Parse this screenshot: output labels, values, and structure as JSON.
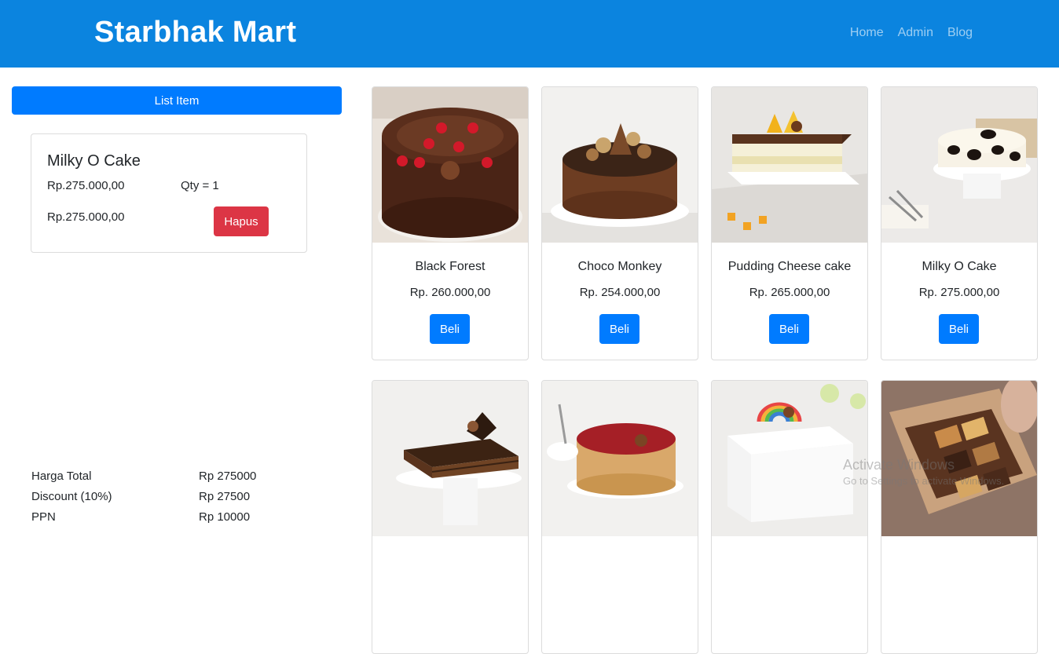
{
  "navbar": {
    "brand": "Starbhak Mart",
    "links": [
      "Home",
      "Admin",
      "Blog"
    ],
    "color": "#0b84df"
  },
  "sidebar": {
    "list_button": "List Item",
    "cart": {
      "name": "Milky O Cake",
      "price": "Rp.275.000,00",
      "qty": "Qty = 1",
      "subtotal": "Rp.275.000,00",
      "remove_label": "Hapus"
    },
    "summary": [
      {
        "label": "Harga Total",
        "value": "Rp 275000"
      },
      {
        "label": "Discount (10%)",
        "value": "Rp 27500"
      },
      {
        "label": "PPN",
        "value": "Rp 10000"
      }
    ]
  },
  "products": [
    {
      "name": "Black Forest",
      "price": "Rp. 260.000,00",
      "buy": "Beli",
      "image": "chocolate-cake-cherries"
    },
    {
      "name": "Choco Monkey",
      "price": "Rp. 254.000,00",
      "buy": "Beli",
      "image": "chocolate-mousse-cake"
    },
    {
      "name": "Pudding Cheese cake",
      "price": "Rp. 265.000,00",
      "buy": "Beli",
      "image": "layered-pudding-cake"
    },
    {
      "name": "Milky O Cake",
      "price": "Rp. 275.000,00",
      "buy": "Beli",
      "image": "cow-pattern-cake"
    },
    {
      "name": "",
      "price": "",
      "buy": "",
      "image": "layered-chocolate-cake"
    },
    {
      "name": "",
      "price": "",
      "buy": "",
      "image": "red-velvet-cake"
    },
    {
      "name": "",
      "price": "",
      "buy": "",
      "image": "rainbow-cake"
    },
    {
      "name": "",
      "price": "",
      "buy": "",
      "image": "brownie-box"
    }
  ],
  "watermark": {
    "title": "Activate Windows",
    "subtitle": "Go to Settings to activate Windows."
  },
  "colors": {
    "primary": "#007bff",
    "danger": "#dc3545"
  }
}
